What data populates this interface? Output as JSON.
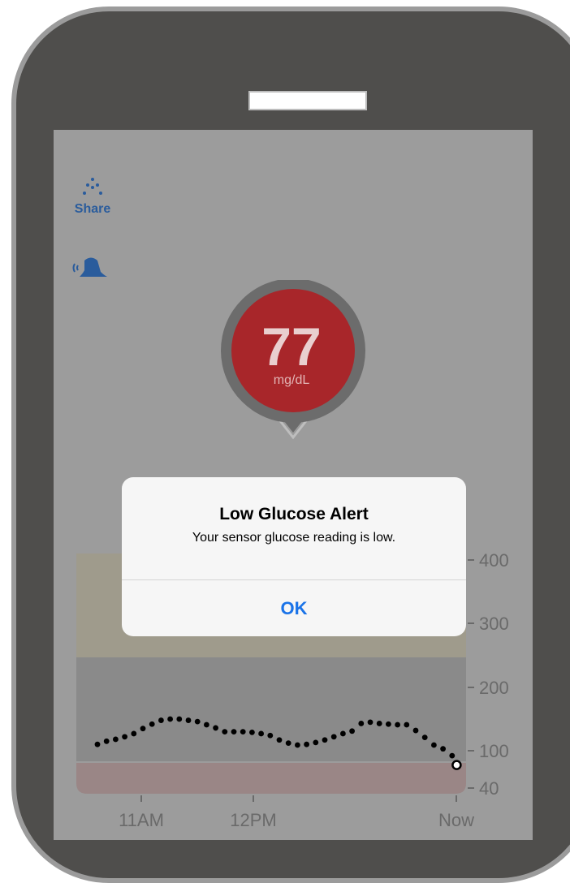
{
  "app": {
    "share_label": "Share",
    "share_icon": "share-dots-icon",
    "alert_icon": "bell-alert-icon"
  },
  "reading": {
    "value": "77",
    "unit": "mg/dL",
    "status_color": "#a8262a"
  },
  "alert_dialog": {
    "title": "Low Glucose Alert",
    "message": "Your sensor glucose reading is low.",
    "ok_label": "OK"
  },
  "colors": {
    "high_zone": "#9f9b8c",
    "target_zone": "#8a8a8a",
    "low_zone": "#9a8686",
    "accent": "#1a73e8",
    "icon_blue": "#2a5c9c"
  },
  "chart_data": {
    "type": "scatter",
    "y_ticks": [
      "400",
      "300",
      "200",
      "100",
      "40"
    ],
    "y_tick_values": [
      400,
      300,
      200,
      100,
      40
    ],
    "x_ticks": [
      "11AM",
      "12PM",
      "Now"
    ],
    "high_threshold": 250,
    "low_threshold": 80,
    "x": [
      0,
      4,
      8,
      12,
      16,
      20,
      24,
      28,
      32,
      36,
      40,
      44,
      48,
      52,
      56,
      60,
      64,
      68,
      72,
      76,
      80,
      84,
      88,
      92,
      96,
      100,
      104,
      108,
      112,
      116,
      120,
      124,
      128,
      132,
      136,
      140,
      144,
      148,
      152,
      156
    ],
    "y": [
      110,
      115,
      118,
      122,
      127,
      135,
      142,
      148,
      150,
      150,
      148,
      146,
      141,
      136,
      130,
      130,
      130,
      129,
      127,
      124,
      117,
      112,
      109,
      110,
      113,
      117,
      122,
      127,
      131,
      143,
      145,
      143,
      142,
      141,
      141,
      132,
      121,
      109,
      103,
      92
    ],
    "latest": {
      "x": 158,
      "y": 77
    }
  }
}
